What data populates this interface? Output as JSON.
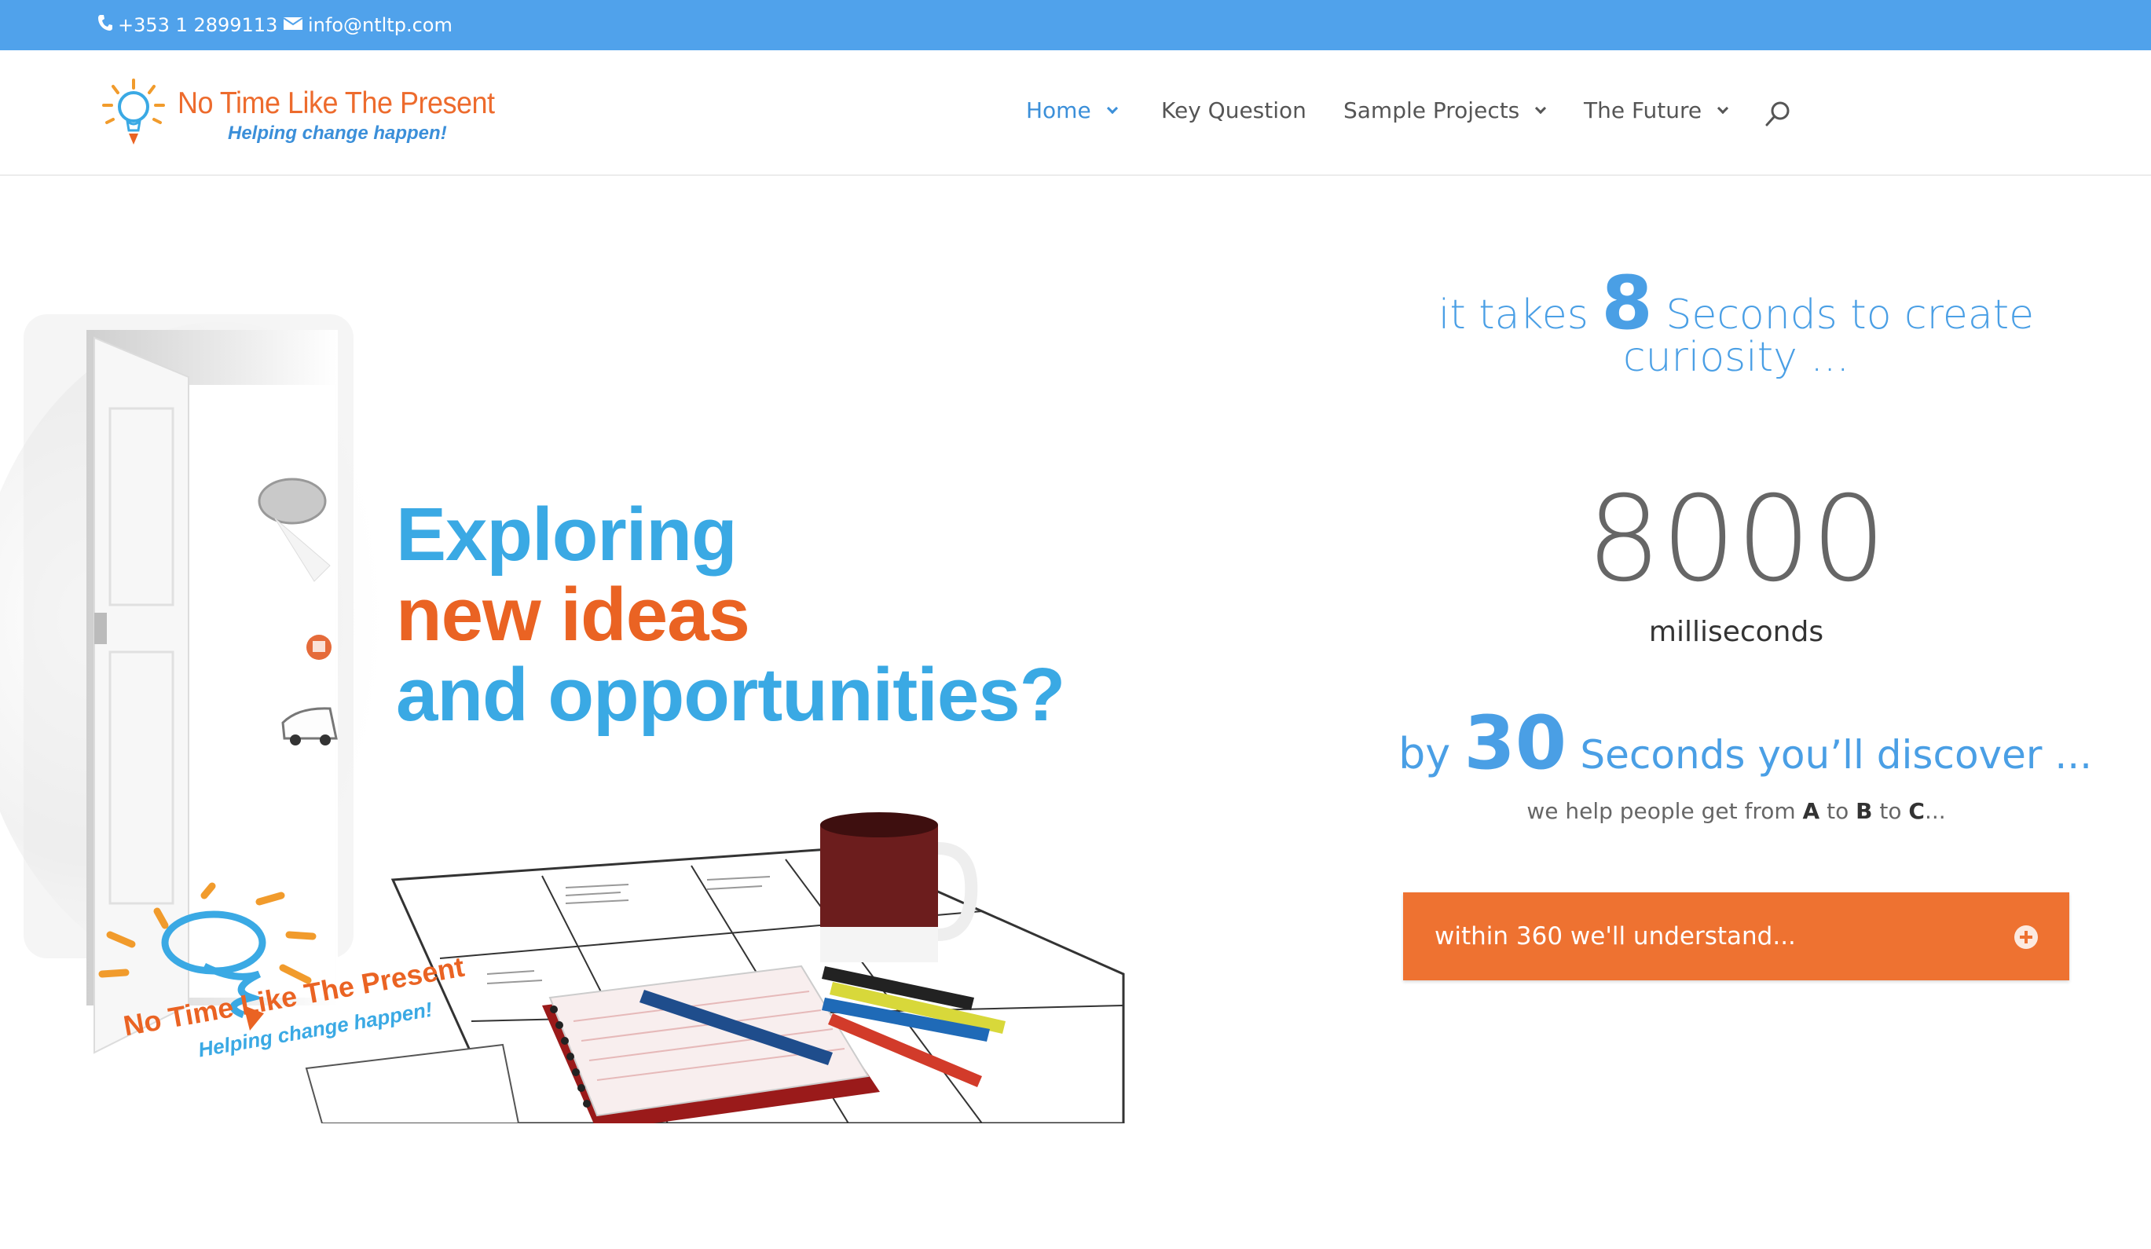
{
  "topbar": {
    "phone": "+353 1 2899113",
    "email": "info@ntltp.com"
  },
  "logo": {
    "name": "No Time Like The Present",
    "tagline": "Helping change happen!"
  },
  "nav": {
    "items": [
      {
        "label": "Home",
        "has_dropdown": true,
        "active": true
      },
      {
        "label": "Key Question",
        "has_dropdown": false,
        "active": false
      },
      {
        "label": "Sample Projects",
        "has_dropdown": true,
        "active": false
      },
      {
        "label": "The Future",
        "has_dropdown": true,
        "active": false
      }
    ]
  },
  "hero": {
    "line1": "Exploring",
    "line2": "new ideas",
    "line3": "and opportunities?",
    "logo_name": "No Time Like The Present",
    "logo_tagline": "Helping change happen!"
  },
  "right": {
    "eight_prefix": "it takes",
    "eight_number": "8",
    "eight_suffix": "Seconds to create",
    "eight_line2": "curiosity ...",
    "counter_value": "8000",
    "counter_unit": "milliseconds",
    "thirty_prefix": "by",
    "thirty_number": "30",
    "thirty_suffix": "Seconds you’ll discover ...",
    "abc_1": "we help people get from",
    "abc_a": "A",
    "abc_to1": "to",
    "abc_b": "B",
    "abc_to2": "to",
    "abc_c": "C",
    "abc_end": "...",
    "toggle_label": "within 360 we'll understand..."
  },
  "colors": {
    "topbar": "#50a2eb",
    "accent_blue": "#4a9fe5",
    "accent_orange": "#ee7231"
  }
}
